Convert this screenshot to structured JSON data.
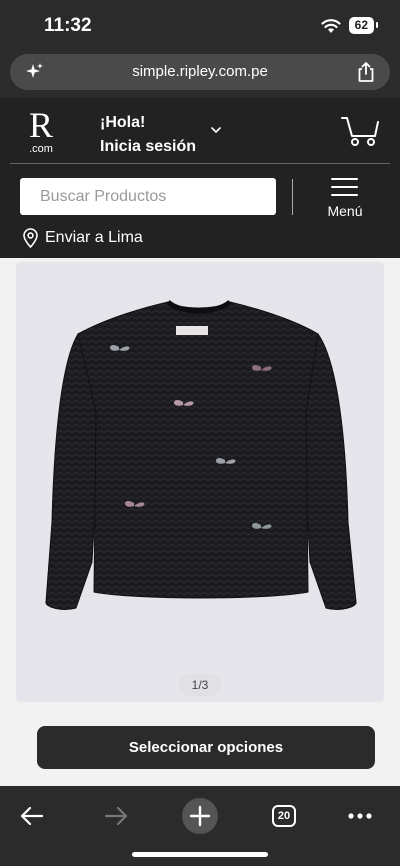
{
  "status_bar": {
    "time": "11:32",
    "battery": "62"
  },
  "browser": {
    "url": "simple.ripley.com.pe",
    "tabs_count": "20"
  },
  "header": {
    "logo_letter": "R",
    "logo_domain": ".com",
    "greeting_line1": "¡Hola!",
    "greeting_line2": "Inicia sesión",
    "search_placeholder": "Buscar Productos",
    "menu_label": "Menú",
    "location_text": "Enviar a Lima"
  },
  "product": {
    "image_counter": "1/3",
    "select_button_label": "Seleccionar opciones"
  },
  "colors": {
    "header_bg": "#222222",
    "browser_chrome": "#2b2b2b",
    "cta_bg": "#2b2b2b",
    "image_bg": "#e6e5ec"
  },
  "icons": [
    "wifi-icon",
    "battery-icon",
    "sparkle-icon",
    "share-icon",
    "chevron-down-icon",
    "cart-icon",
    "hamburger-icon",
    "pin-icon",
    "back-arrow-icon",
    "forward-arrow-icon",
    "plus-icon",
    "tabs-icon",
    "more-icon"
  ]
}
